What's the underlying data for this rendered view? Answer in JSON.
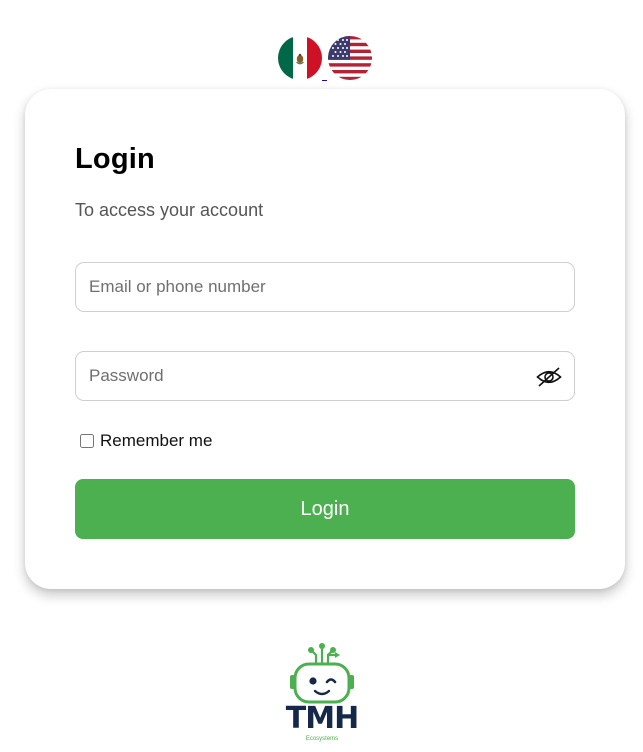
{
  "language_selector": {
    "options": [
      {
        "code": "es-MX",
        "icon": "mexico-flag-icon"
      },
      {
        "code": "en-US",
        "icon": "usa-flag-icon"
      }
    ]
  },
  "login_card": {
    "title": "Login",
    "subtitle": "To access your account",
    "email_placeholder": "Email or phone number",
    "email_value": "",
    "password_placeholder": "Password",
    "password_value": "",
    "password_toggle_icon": "eye-slash-icon",
    "remember_label": "Remember me",
    "remember_checked": false,
    "submit_label": "Login"
  },
  "brand": {
    "logo_icon": "robot-logo-icon",
    "name": "TMH",
    "tagline": "Ecosystems"
  },
  "colors": {
    "accent": "#4caf50",
    "brand_dark": "#15284a",
    "mexico_green": "#006847",
    "mexico_red": "#ce1126",
    "usa_blue": "#3c3b6e",
    "usa_red": "#b22234"
  }
}
